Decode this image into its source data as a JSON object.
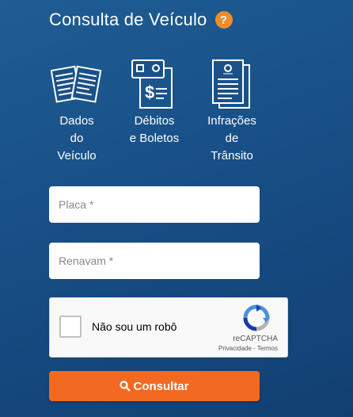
{
  "header": {
    "title": "Consulta de Veículo",
    "help_icon": "question-circle-icon",
    "help_label": "?"
  },
  "categories": [
    {
      "label": "Dados\ndo\nVeículo",
      "icon": "vehicle-documents-icon"
    },
    {
      "label": "Débitos\ne Boletos",
      "icon": "invoice-dollar-icon"
    },
    {
      "label": "Infrações\nde\nTrânsito",
      "icon": "traffic-fine-document-icon"
    }
  ],
  "form": {
    "placa_placeholder": "Placa *",
    "renavam_placeholder": "Renavam *"
  },
  "recaptcha": {
    "checkbox_label": "Não sou um robô",
    "brand": "reCAPTCHA",
    "privacy": "Privacidade",
    "separator": " - ",
    "terms": "Termos"
  },
  "submit": {
    "label": "Consultar",
    "icon": "search-icon"
  },
  "colors": {
    "accent": "#f26a21",
    "help": "#f28c28",
    "background": "#174f86"
  }
}
